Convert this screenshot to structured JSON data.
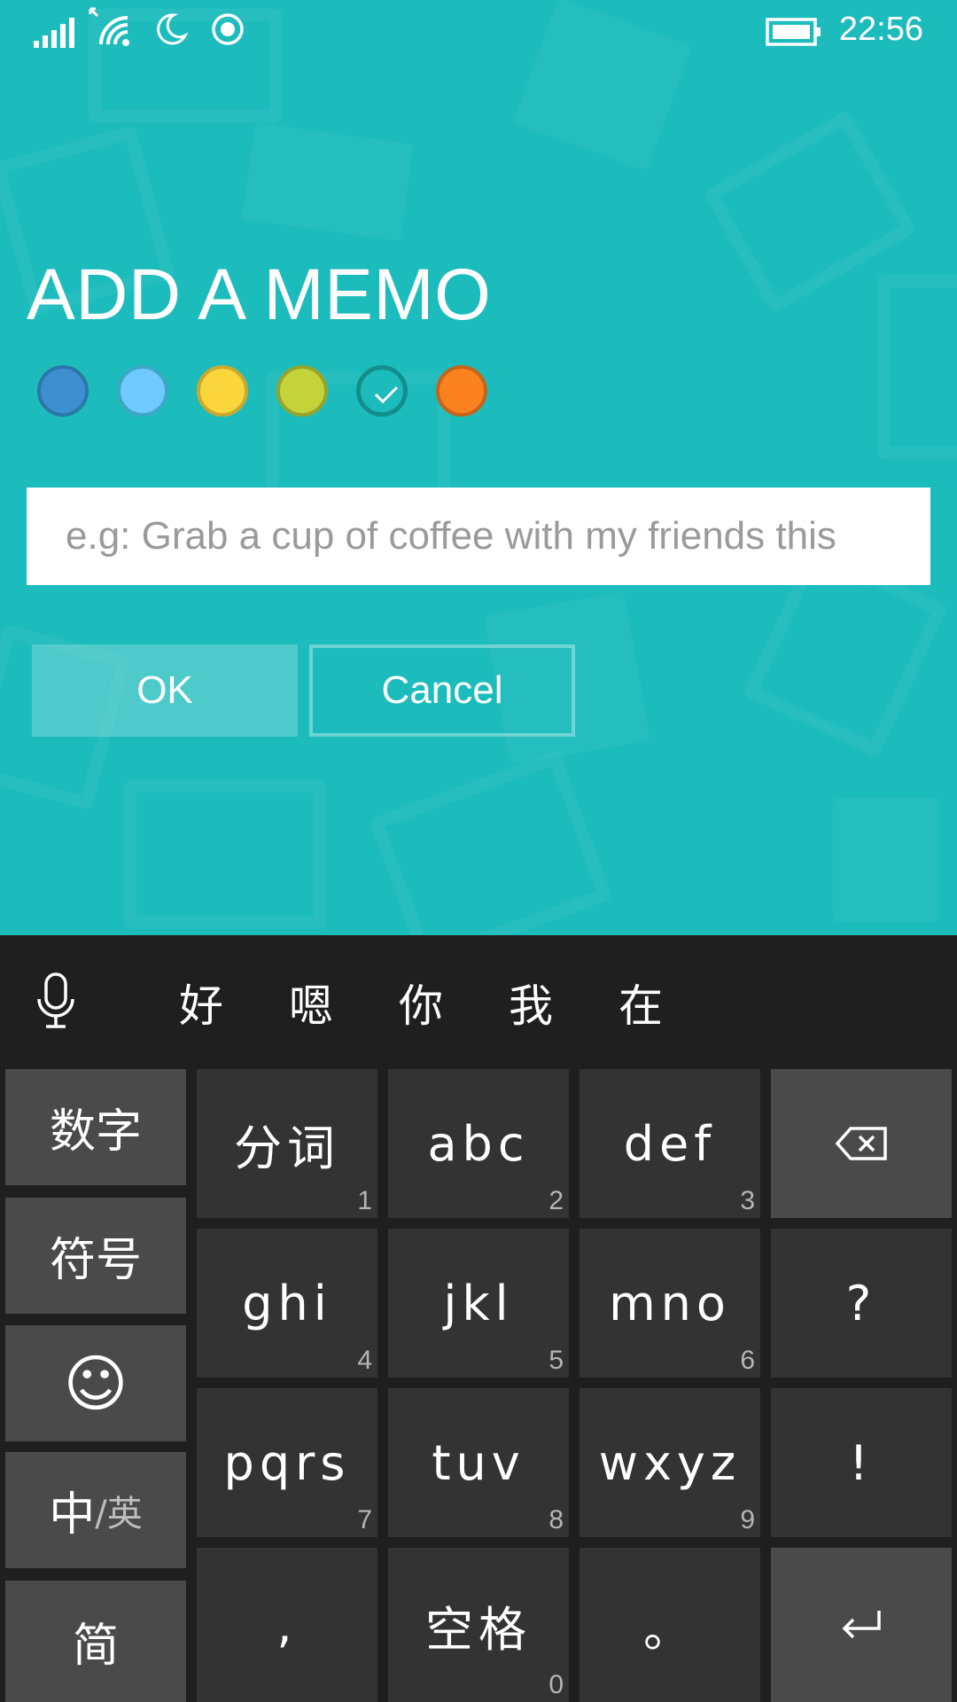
{
  "status": {
    "time": "22:56",
    "icons": [
      "signal-bars-icon",
      "wifi-icon",
      "quiet-hours-moon-icon",
      "location-dot-icon",
      "battery-icon"
    ]
  },
  "memo": {
    "title": "ADD A MEMO",
    "placeholder": "e.g: Grab a cup of coffee with my friends this",
    "ok_label": "OK",
    "cancel_label": "Cancel",
    "colors": [
      {
        "name": "blue",
        "hex": "#3d8fd0",
        "selected": false
      },
      {
        "name": "light-blue",
        "hex": "#6fcaff",
        "selected": false
      },
      {
        "name": "yellow",
        "hex": "#fbd53c",
        "selected": false
      },
      {
        "name": "lime",
        "hex": "#c3d339",
        "selected": false
      },
      {
        "name": "teal",
        "hex": "#1dbcbc",
        "selected": true
      },
      {
        "name": "orange",
        "hex": "#fb821f",
        "selected": false
      }
    ]
  },
  "keyboard": {
    "candidates": [
      "好",
      "嗯",
      "你",
      "我",
      "在"
    ],
    "side_keys": [
      "数字",
      "符号",
      "☺",
      "中",
      "/英",
      "简"
    ],
    "keys": {
      "k1": {
        "label": "分词",
        "num": "1"
      },
      "k2": {
        "label": "abc",
        "num": "2"
      },
      "k3": {
        "label": "def",
        "num": "3"
      },
      "k4": {
        "label": "ghi",
        "num": "4"
      },
      "k5": {
        "label": "jkl",
        "num": "5"
      },
      "k6": {
        "label": "mno",
        "num": "6"
      },
      "k7": {
        "label": "pqrs",
        "num": "7"
      },
      "k8": {
        "label": "tuv",
        "num": "8"
      },
      "k9": {
        "label": "wxyz",
        "num": "9"
      },
      "comma": {
        "label": ","
      },
      "space": {
        "label": "空格",
        "num": "0"
      },
      "period": {
        "label": "。"
      },
      "question": {
        "label": "?"
      },
      "exclaim": {
        "label": "!"
      }
    }
  }
}
